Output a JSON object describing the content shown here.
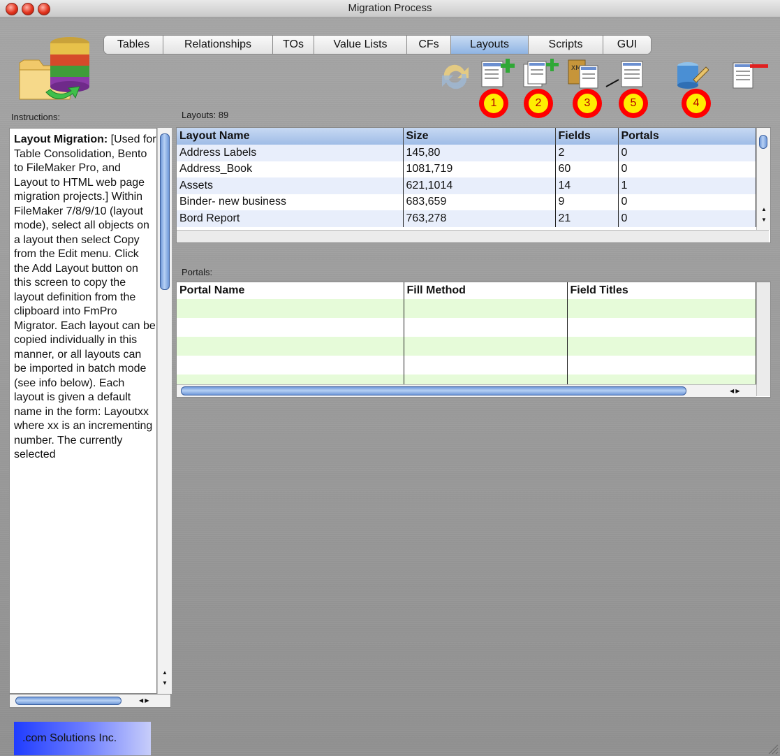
{
  "window": {
    "title": "Migration Process"
  },
  "tabs": [
    {
      "label": "Tables",
      "active": false
    },
    {
      "label": "Relationships",
      "active": false
    },
    {
      "label": "TOs",
      "active": false
    },
    {
      "label": "Value Lists",
      "active": false
    },
    {
      "label": "CFs",
      "active": false
    },
    {
      "label": "Layouts",
      "active": true
    },
    {
      "label": "Scripts",
      "active": false
    },
    {
      "label": "GUI",
      "active": false
    }
  ],
  "toolbar": {
    "badges": [
      "1",
      "2",
      "3",
      "5",
      "4"
    ],
    "icons": [
      "refresh-icon",
      "add-layout-icon",
      "add-layouts-batch-icon",
      "xml-import-icon",
      "layout-link-icon",
      "database-edit-icon",
      "layout-delete-icon"
    ]
  },
  "instructions": {
    "label": "Instructions:",
    "heading": "Layout Migration:",
    "body": "[Used for Table Consolidation, Bento to FileMaker Pro, and Layout to HTML web page migration projects.] Within FileMaker 7/8/9/10 (layout mode), select all objects on a layout then select Copy from the Edit menu. Click the Add Layout button on this screen to copy the layout definition from the clipboard into FmPro Migrator. Each layout can be copied individually in this manner, or all layouts can be imported in batch mode (see info below). Each layout is given a default name in the form: Layoutxx where xx is an incrementing number.  The currently selected"
  },
  "layouts": {
    "label": "Layouts: 89",
    "columns": [
      "Layout Name",
      "Size",
      "Fields",
      "Portals"
    ],
    "rows": [
      [
        "Address Labels",
        "145,80",
        "2",
        "0"
      ],
      [
        "Address_Book",
        "1081,719",
        "60",
        "0"
      ],
      [
        "Assets",
        "621,1014",
        "14",
        "1"
      ],
      [
        "Binder- new business",
        "683,659",
        "9",
        "0"
      ],
      [
        "Bord Report",
        "763,278",
        "21",
        "0"
      ]
    ]
  },
  "portals": {
    "label": "Portals:",
    "columns": [
      "Portal Name",
      "Fill Method",
      "Field Titles"
    ],
    "rows": [
      [
        "",
        "",
        ""
      ],
      [
        "",
        "",
        ""
      ],
      [
        "",
        "",
        ""
      ],
      [
        "",
        "",
        ""
      ],
      [
        "",
        "",
        ""
      ]
    ]
  },
  "footer": {
    "company": ".com Solutions Inc."
  }
}
